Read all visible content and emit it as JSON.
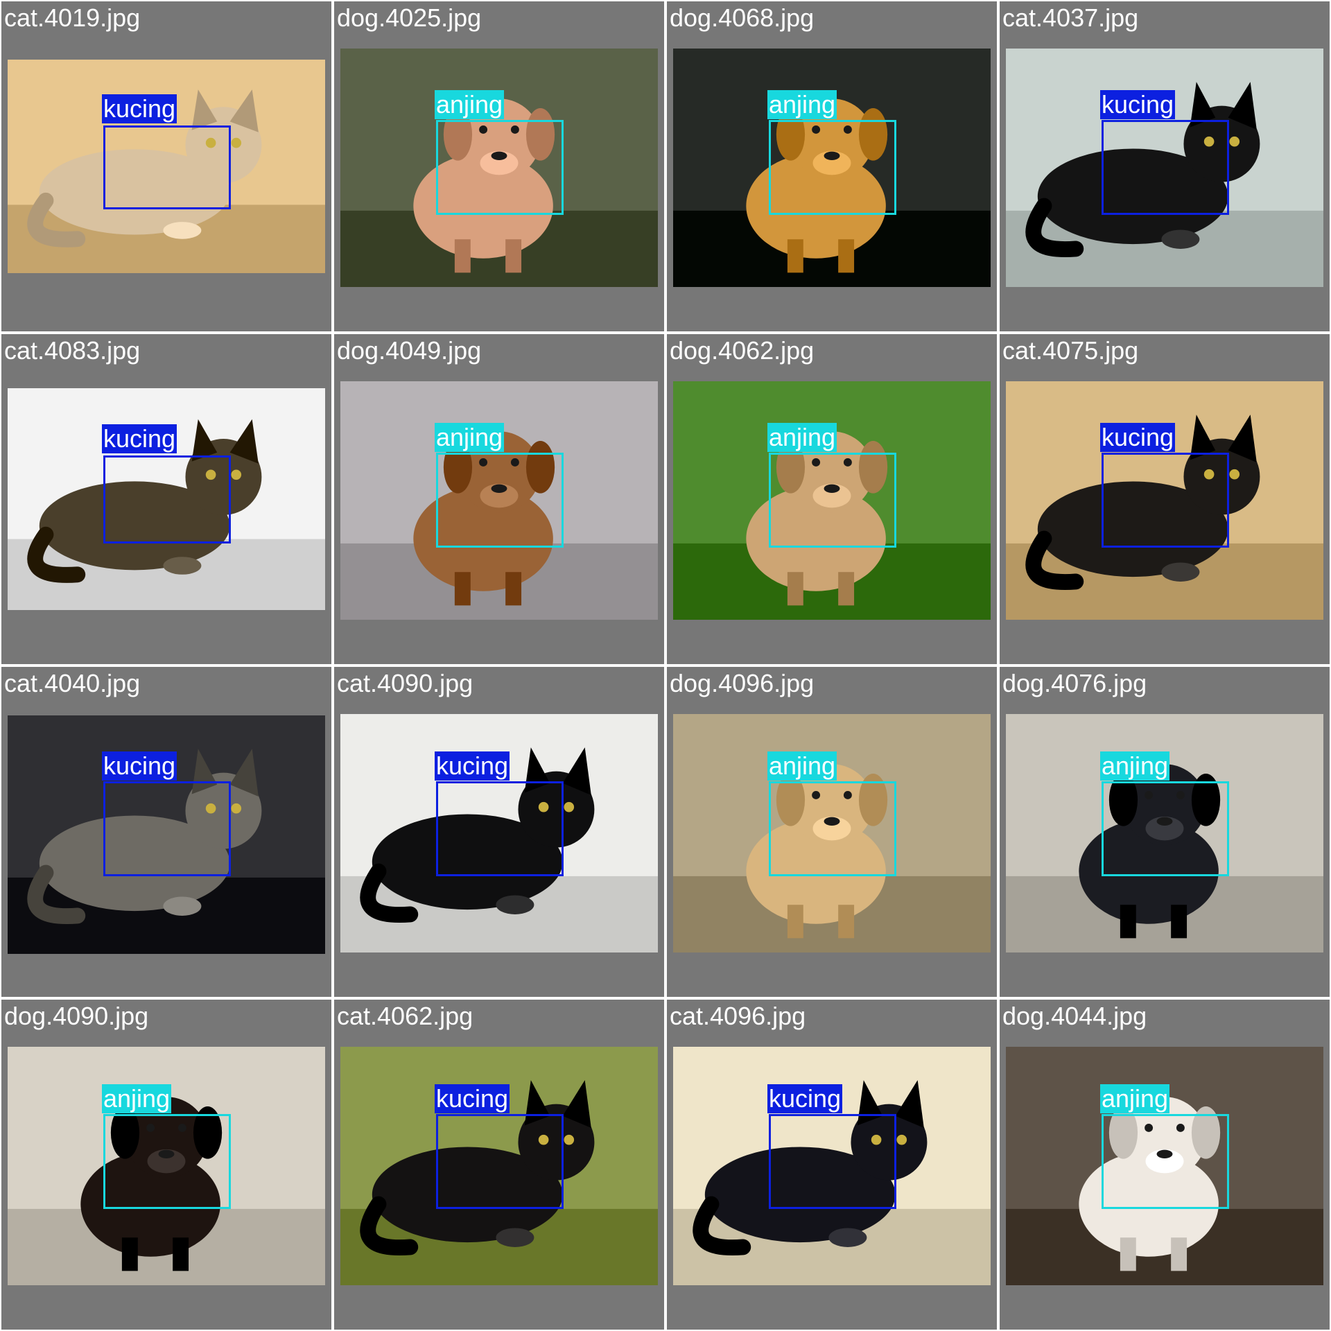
{
  "class_colors": {
    "kucing": "#0c20e0",
    "anjing": "#18d8de"
  },
  "tiles": [
    {
      "filename": "cat.4019.jpg",
      "label": "kucing",
      "subject": "cat",
      "fur": "#d9c2a0",
      "bg": "#e8c78f"
    },
    {
      "filename": "dog.4025.jpg",
      "label": "anjing",
      "subject": "dog",
      "fur": "#d9a07e",
      "bg": "#5a6248"
    },
    {
      "filename": "dog.4068.jpg",
      "label": "anjing",
      "subject": "dog",
      "fur": "#d2963c",
      "bg": "#262a26"
    },
    {
      "filename": "cat.4037.jpg",
      "label": "kucing",
      "subject": "cat",
      "fur": "#141414",
      "bg": "#c9d3cf"
    },
    {
      "filename": "cat.4083.jpg",
      "label": "kucing",
      "subject": "cat",
      "fur": "#4a3f2b",
      "bg": "#f3f3f3"
    },
    {
      "filename": "dog.4049.jpg",
      "label": "anjing",
      "subject": "dog",
      "fur": "#9a6336",
      "bg": "#b7b3b6"
    },
    {
      "filename": "dog.4062.jpg",
      "label": "anjing",
      "subject": "dog",
      "fur": "#cda574",
      "bg": "#4f8c2e"
    },
    {
      "filename": "cat.4075.jpg",
      "label": "kucing",
      "subject": "cat",
      "fur": "#1d1a17",
      "bg": "#d9bb86"
    },
    {
      "filename": "cat.4040.jpg",
      "label": "kucing",
      "subject": "cat",
      "fur": "#6e6b64",
      "bg": "#2f2f33"
    },
    {
      "filename": "cat.4090.jpg",
      "label": "kucing",
      "subject": "cat",
      "fur": "#0f0f10",
      "bg": "#ededea"
    },
    {
      "filename": "dog.4096.jpg",
      "label": "anjing",
      "subject": "dog",
      "fur": "#d9b57e",
      "bg": "#b4a686"
    },
    {
      "filename": "dog.4076.jpg",
      "label": "anjing",
      "subject": "dog",
      "fur": "#1b1c22",
      "bg": "#c9c5bb"
    },
    {
      "filename": "dog.4090.jpg",
      "label": "anjing",
      "subject": "dog",
      "fur": "#1e1410",
      "bg": "#d8d2c6"
    },
    {
      "filename": "cat.4062.jpg",
      "label": "kucing",
      "subject": "cat",
      "fur": "#141212",
      "bg": "#8c9a4c"
    },
    {
      "filename": "cat.4096.jpg",
      "label": "kucing",
      "subject": "cat",
      "fur": "#13131a",
      "bg": "#efe5c9"
    },
    {
      "filename": "dog.4044.jpg",
      "label": "anjing",
      "subject": "dog",
      "fur": "#efe9e1",
      "bg": "#5e5348"
    }
  ]
}
